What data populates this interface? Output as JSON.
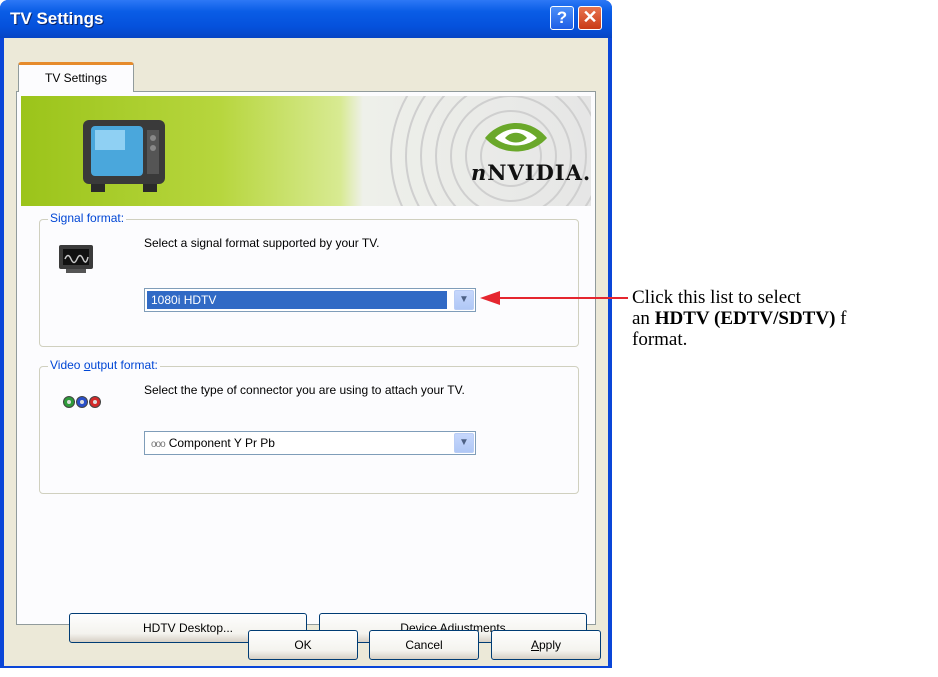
{
  "window": {
    "title": "TV Settings",
    "help_button": "?",
    "close_button": "✕"
  },
  "tabs": [
    {
      "label": "TV Settings",
      "active": true
    }
  ],
  "banner": {
    "brand": "NVIDIA.",
    "brand_prefix": "n"
  },
  "signal_format": {
    "legend": "Signal format:",
    "description": "Select a signal format supported by your TV.",
    "selected_value": "1080i HDTV",
    "icon": "signal-monitor-icon"
  },
  "video_output": {
    "legend_pre": "Video ",
    "legend_underlined": "o",
    "legend_post": "utput format:",
    "description": "Select the type of connector you are using to attach your TV.",
    "selected_value": "Component Y Pr Pb",
    "icon": "rca-connector-icon"
  },
  "buttons": {
    "hdtv_desktop": "HDTV Desktop...",
    "device_adjustments": "Device Adjustments",
    "ok": "OK",
    "cancel": "Cancel",
    "apply_underlined": "A",
    "apply_rest": "pply"
  },
  "annotation": {
    "line1": "Click this list to select",
    "line2_pre": "an ",
    "line2_bold": "HDTV (EDTV/SDTV)",
    "line2_post": " f",
    "line3": "format."
  },
  "colors": {
    "title_bar": "#0a5de6",
    "selection": "#316ac5",
    "arrow": "#e5262f",
    "legend_text": "#0046d5",
    "banner_green": "#9bc41a"
  }
}
